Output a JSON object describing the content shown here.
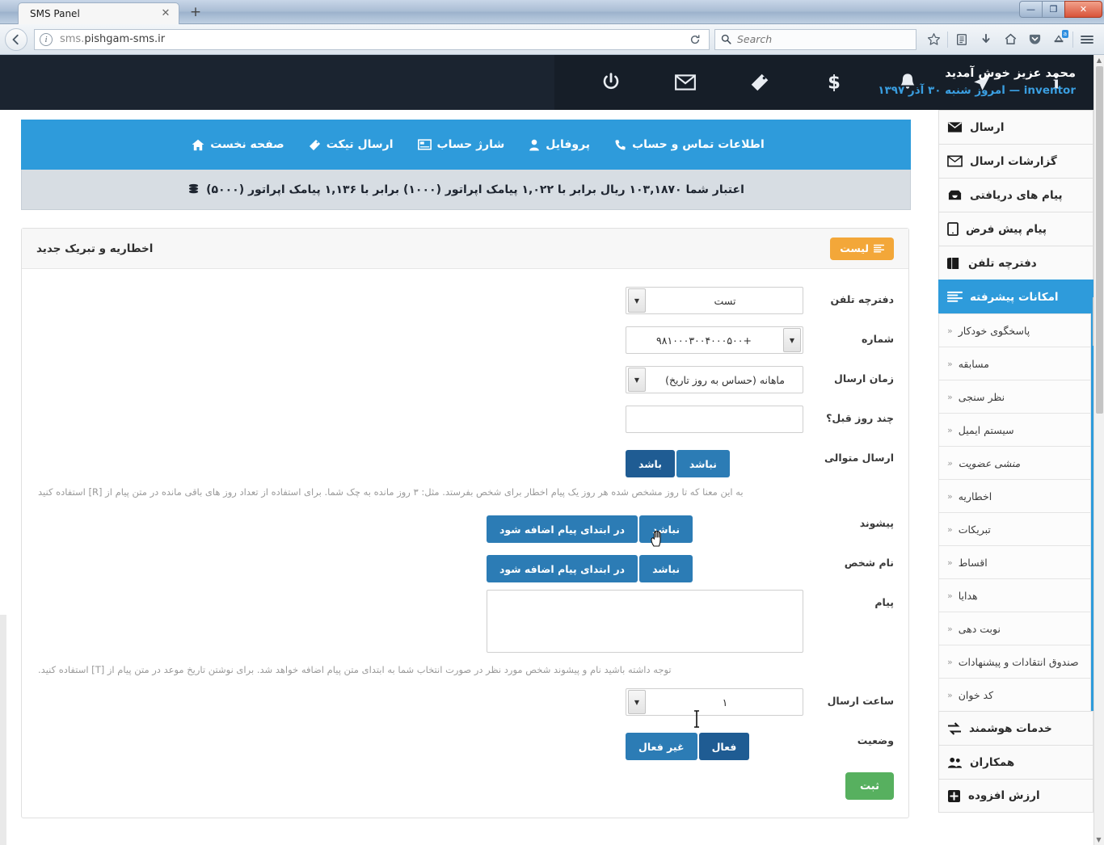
{
  "browser": {
    "tab_title": "SMS Panel",
    "tab_close": "✕",
    "newtab": "+",
    "url_prefix": "sms.",
    "url_main": "pishgam-sms.ir",
    "url_full": "sms.pishgam-sms.ir",
    "search_placeholder": "Search",
    "back_glyph": "←",
    "reload_glyph": "⟳",
    "win_min": "—",
    "win_max": "❐",
    "win_close": "✕",
    "addon_badge": "a"
  },
  "topbar": {
    "welcome_line1": "محمد عزیز خوش آمدید",
    "welcome_line2": "inventor — امروز شنبه ۳۰ آذر ۱۳۹۷",
    "icons": [
      "power-icon",
      "envelope-icon",
      "ticket-icon",
      "dollar-icon",
      "bell-icon",
      "paper-plane-icon",
      "info-icon"
    ]
  },
  "bluenav": {
    "items": [
      {
        "label": "اطلاعات تماس و حساب",
        "icon": "phone-icon"
      },
      {
        "label": "پروفایل",
        "icon": "user-icon"
      },
      {
        "label": "شارژ حساب",
        "icon": "card-icon"
      },
      {
        "label": "ارسال تیکت",
        "icon": "tag-icon"
      },
      {
        "label": "صفحه نخست",
        "icon": "home-icon"
      }
    ]
  },
  "creditbar": {
    "text": "اعتبار شما ۱۰۳,۱۸۷۰ ریال برابر با ۱,۰۲۲ پیامک اپراتور (۱۰۰۰) برابر با ۱,۱۳۶ پیامک اپراتور (۵۰۰۰)",
    "icon": "coins-icon"
  },
  "sidebar": {
    "items": [
      {
        "label": "ارسال",
        "icon": "envelope-solid-icon",
        "active": false
      },
      {
        "label": "گزارشات ارسال",
        "icon": "envelope-open-icon",
        "active": false
      },
      {
        "label": "پیام های دریافتی",
        "icon": "inbox-icon",
        "active": false
      },
      {
        "label": "پیام پیش فرض",
        "icon": "tablet-icon",
        "active": false
      },
      {
        "label": "دفترچه تلفن",
        "icon": "book-icon",
        "active": false
      },
      {
        "label": "امکانات پیشرفته",
        "icon": "list-icon",
        "active": true
      }
    ],
    "submenu": [
      {
        "label": "پاسخگوی خودکار",
        "italic": false
      },
      {
        "label": "مسابقه",
        "italic": false
      },
      {
        "label": "نظر سنجی",
        "italic": false
      },
      {
        "label": "سیستم ایمیل",
        "italic": false
      },
      {
        "label": "منشی عضویت",
        "italic": true
      },
      {
        "label": "اخطاریه",
        "italic": false
      },
      {
        "label": "تبریکات",
        "italic": false
      },
      {
        "label": "اقساط",
        "italic": false
      },
      {
        "label": "هدایا",
        "italic": false
      },
      {
        "label": "نوبت دهی",
        "italic": false
      },
      {
        "label": "صندوق انتقادات و پیشنهادات",
        "italic": false
      },
      {
        "label": "کد خوان",
        "italic": false
      }
    ],
    "chevron": "«",
    "footer_items": [
      {
        "label": "خدمات هوشمند",
        "icon": "exchange-icon"
      },
      {
        "label": "همکاران",
        "icon": "users-icon"
      },
      {
        "label": "ارزش افزوده",
        "icon": "plus-square-icon"
      }
    ]
  },
  "panel": {
    "title": "اخطاریه و تبریک جدید",
    "list_button": "لیست",
    "list_button_icon": "list-icon",
    "fields": {
      "phonebook": {
        "label": "دفترچه تلفن",
        "value": "تست"
      },
      "number": {
        "label": "شماره",
        "value": "+۹۸۱۰۰۰۳۰۰۴۰۰۰۵۰۰"
      },
      "send_time": {
        "label": "زمان ارسال",
        "value": "ماهانه (حساس به روز تاریخ)"
      },
      "days_before": {
        "label": "چند روز قبل؟",
        "value": ""
      },
      "consecutive": {
        "label": "ارسال متوالی",
        "options": [
          "نباشد",
          "باشد"
        ],
        "selected": "باشد"
      },
      "prefix": {
        "label": "پیشوند",
        "options": [
          "نباشد",
          "در ابتدای پیام اضافه شود"
        ],
        "selected": "نباشد"
      },
      "person_name": {
        "label": "نام شخص",
        "options": [
          "نباشد",
          "در ابتدای پیام اضافه شود"
        ],
        "selected": "نباشد"
      },
      "message": {
        "label": "پیام",
        "value": ""
      },
      "send_hour": {
        "label": "ساعت ارسال",
        "value": "۱"
      },
      "status": {
        "label": "وضعیت",
        "options": [
          "فعال",
          "غیر فعال"
        ],
        "selected": "فعال"
      }
    },
    "hint_consecutive": "به این معنا که تا روز مشخص شده هر روز یک پیام اخطار برای شخص بفرستد. مثل: ۳ روز مانده به چک شما. برای استفاده از تعداد روز های باقی مانده در متن پیام از [R] استفاده کنید",
    "hint_message": "توجه داشته باشید نام و پیشوند شخص مورد نظر در صورت انتخاب شما به ابتدای متن پیام اضافه خواهد شد. برای نوشتن تاریخ موعد در متن پیام از [T] استفاده کنید.",
    "submit_label": "ثبت"
  },
  "colors": {
    "brand_blue": "#2e9bdb",
    "dark_header": "#1b2430",
    "orange": "#f3a739",
    "green": "#57b05f",
    "button_blue": "#2c7cb5",
    "button_blue_selected": "#1f5c93"
  }
}
